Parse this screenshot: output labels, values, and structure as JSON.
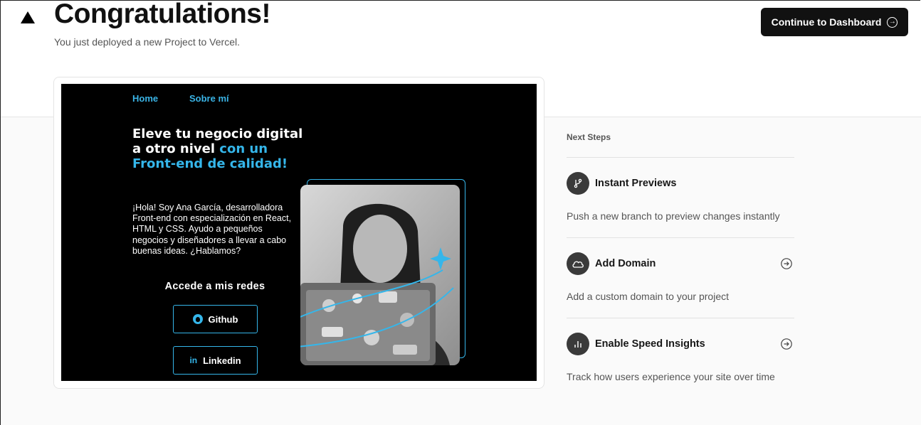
{
  "header": {
    "title": "Congratulations!",
    "subtitle": "You just deployed a new Project to Vercel.",
    "cta_label": "Continue to Dashboard"
  },
  "preview": {
    "nav": [
      "Home",
      "Sobre mí"
    ],
    "headline_white": "Eleve tu negocio digital a otro nivel",
    "headline_accent": "con un Front-end de calidad!",
    "intro": "¡Hola! Soy Ana García, desarrolladora Front-end con especialización en React, HTML y CSS. Ayudo a pequeños negocios y diseñadores a llevar a cabo buenas ideas. ¿Hablamos?",
    "social_heading": "Accede a mis redes",
    "buttons": {
      "github": "Github",
      "linkedin": "Linkedin"
    },
    "linkedin_glyph": "in"
  },
  "next_steps": {
    "heading": "Next Steps",
    "items": [
      {
        "title": "Instant Previews",
        "desc": "Push a new branch to preview changes instantly",
        "icon": "git-branch-icon"
      },
      {
        "title": "Add Domain",
        "desc": "Add a custom domain to your project",
        "icon": "cloud-icon"
      },
      {
        "title": "Enable Speed Insights",
        "desc": "Track how users experience your site over time",
        "icon": "bar-chart-icon"
      }
    ]
  },
  "colors": {
    "accent": "#35b6ea",
    "button_bg": "#111111",
    "page_bg": "#fafafa"
  }
}
